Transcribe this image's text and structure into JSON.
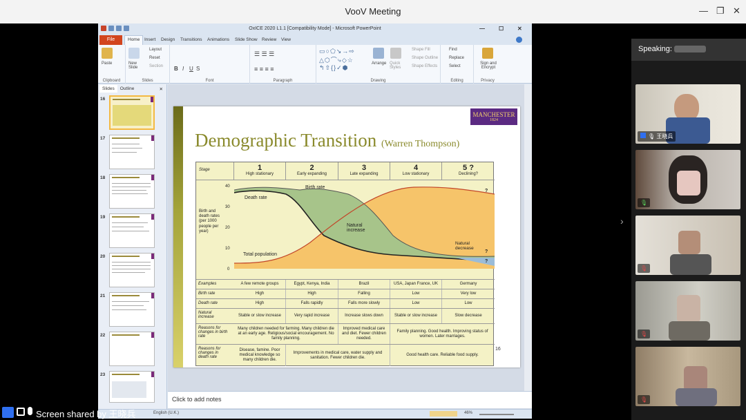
{
  "window": {
    "title": "VooV Meeting"
  },
  "ppt": {
    "title": "OxICE 2020 L1.1 [Compatibility Mode] - Microsoft PowerPoint",
    "tabs": [
      "File",
      "Home",
      "Insert",
      "Design",
      "Transitions",
      "Animations",
      "Slide Show",
      "Review",
      "View"
    ],
    "groups": [
      "Clipboard",
      "Slides",
      "Font",
      "Paragraph",
      "Drawing",
      "Editing",
      "Privacy"
    ],
    "ribbon": {
      "paste": "Paste",
      "new_slide": "New Slide",
      "layout": "Layout",
      "reset": "Reset",
      "section": "Section",
      "arrange": "Arrange",
      "quick_styles": "Quick Styles",
      "shape_fill": "Shape Fill",
      "shape_outline": "Shape Outline",
      "shape_effects": "Shape Effects",
      "find": "Find",
      "replace": "Replace",
      "select": "Select",
      "sign": "Sign and Encrypt"
    },
    "panel_tabs": [
      "Slides",
      "Outline"
    ],
    "slide_numbers": [
      "16",
      "17",
      "18",
      "19",
      "20",
      "21",
      "22",
      "23"
    ],
    "notes_placeholder": "Click to add notes",
    "status_language": "English (U.K.)",
    "zoom": "46%"
  },
  "slide": {
    "title": "Demographic Transition",
    "subtitle": "(Warren Thompson)",
    "logo": "MANCHESTER",
    "logo_year": "1824",
    "page_number": "16",
    "stage_label": "Stage",
    "stages": [
      {
        "num": "1",
        "name": "High stationary"
      },
      {
        "num": "2",
        "name": "Early expanding"
      },
      {
        "num": "3",
        "name": "Late expanding"
      },
      {
        "num": "4",
        "name": "Low stationary"
      },
      {
        "num": "5 ?",
        "name": "Declining?"
      }
    ],
    "ylabel": "Birth and death rates (per 1000 people per year)",
    "yticks": [
      "40",
      "30",
      "20",
      "10",
      "0"
    ],
    "curve_labels": {
      "birth": "Birth rate",
      "death": "Death rate",
      "natural_increase": "Natural increase",
      "total_population": "Total population",
      "natural_decrease": "Natural decrease",
      "q1": "?",
      "q2": "?",
      "q3": "?"
    },
    "rows": [
      {
        "label": "Examples",
        "cells": [
          "A few remote groups",
          "Egypt, Kenya, India",
          "Brazil",
          "USA, Japan France, UK",
          "Germany"
        ]
      },
      {
        "label": "Birth rate",
        "cells": [
          "High",
          "High",
          "Falling",
          "Low",
          "Very low"
        ]
      },
      {
        "label": "Death rate",
        "cells": [
          "High",
          "Falls rapidly",
          "Falls more slowly",
          "Low",
          "Low"
        ]
      },
      {
        "label": "Natural increase",
        "cells": [
          "Stable or slow increase",
          "Very rapid increase",
          "Increase slows down",
          "Stable or slow increase",
          "Slow decrease"
        ]
      },
      {
        "label": "Reasons for changes in birth rate",
        "cells": [
          "Many children needed for farming. Many children die at an early age. Religious/social encouragement. No family planning.",
          "Improved medical care and diet. Fewer children needed.",
          "Family planning. Good health. Improving status of women. Later marriages."
        ]
      },
      {
        "label": "Reasons for changes in death rate",
        "cells": [
          "Disease, famine. Poor medical knowledge so many children die.",
          "Improvements in medical care, water supply and sanitation. Fewer children die.",
          "Good health care. Reliable food supply."
        ]
      }
    ]
  },
  "meeting": {
    "speaking": "Speaking:",
    "participants": [
      {
        "name": "王晓兵"
      },
      {
        "name": ""
      },
      {
        "name": ""
      },
      {
        "name": ""
      },
      {
        "name": ""
      }
    ],
    "screen_share": "Screen shared by 王晓兵"
  },
  "colors": {
    "brand_purple": "#5b2a82",
    "slide_olive": "#8a8a2c",
    "file_tab": "#d2451e",
    "share_icon": "#2f6ff0"
  }
}
